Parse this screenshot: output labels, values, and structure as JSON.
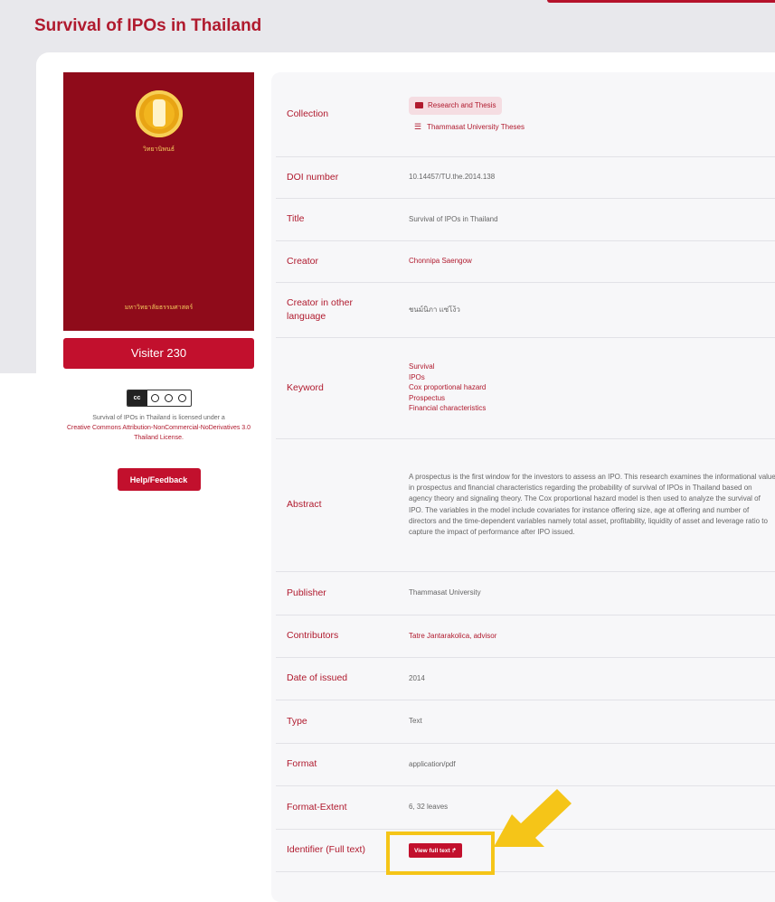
{
  "page": {
    "title": "Survival of IPOs in Thailand"
  },
  "cover": {
    "top_text": "วิทยานิพนธ์",
    "bottom_text": "มหาวิทยาลัยธรรมศาสตร์"
  },
  "visitor": {
    "label": "Visiter 230"
  },
  "license": {
    "badge_text": "cc",
    "text_before": "Survival of IPOs in Thailand is licensed under a",
    "link_text": "Creative Commons Attribution-NonCommercial-NoDerivatives 3.0 Thailand License."
  },
  "help": {
    "label": "Help/Feedback"
  },
  "metadata": {
    "collection": {
      "label": "Collection",
      "chip": "Research and Thesis",
      "sub": "Thammasat University Theses"
    },
    "doi": {
      "label": "DOI number",
      "value": "10.14457/TU.the.2014.138"
    },
    "title": {
      "label": "Title",
      "value": "Survival of IPOs in Thailand"
    },
    "creator": {
      "label": "Creator",
      "value": "Chonnipa Saengow"
    },
    "creator_other": {
      "label": "Creator in other language",
      "value": "ชนม์นิภา แซ่โง้ว"
    },
    "keyword": {
      "label": "Keyword",
      "values": [
        "Survival",
        "IPOs",
        "Cox proportional hazard",
        "Prospectus",
        "Financial characteristics"
      ]
    },
    "abstract": {
      "label": "Abstract",
      "value": "A prospectus is the first window for the investors to assess an IPO. This research examines the informational value in prospectus and financial characteristics regarding the probability of survival of IPOs in Thailand based on agency theory and signaling theory. The Cox proportional hazard model is then used to analyze the survival of IPO. The variables in the model include covariates for instance offering size, age at offering and number of directors and the time-dependent variables namely total asset, profitability, liquidity of asset and leverage ratio to capture the impact of performance after IPO issued."
    },
    "publisher": {
      "label": "Publisher",
      "value": "Thammasat University"
    },
    "contributors": {
      "label": "Contributors",
      "value": "Tatre Jantarakolica, advisor"
    },
    "date": {
      "label": "Date of issued",
      "value": "2014"
    },
    "type": {
      "label": "Type",
      "value": "Text"
    },
    "format": {
      "label": "Format",
      "value": "application/pdf"
    },
    "extent": {
      "label": "Format-Extent",
      "value": "6, 32 leaves"
    },
    "identifier": {
      "label": "Identifier (Full text)",
      "button": "View full text ↱"
    }
  },
  "colors": {
    "brand": "#b01a2e",
    "button": "#c2102d",
    "cover": "#8f0b1a",
    "highlight": "#f5c518"
  }
}
